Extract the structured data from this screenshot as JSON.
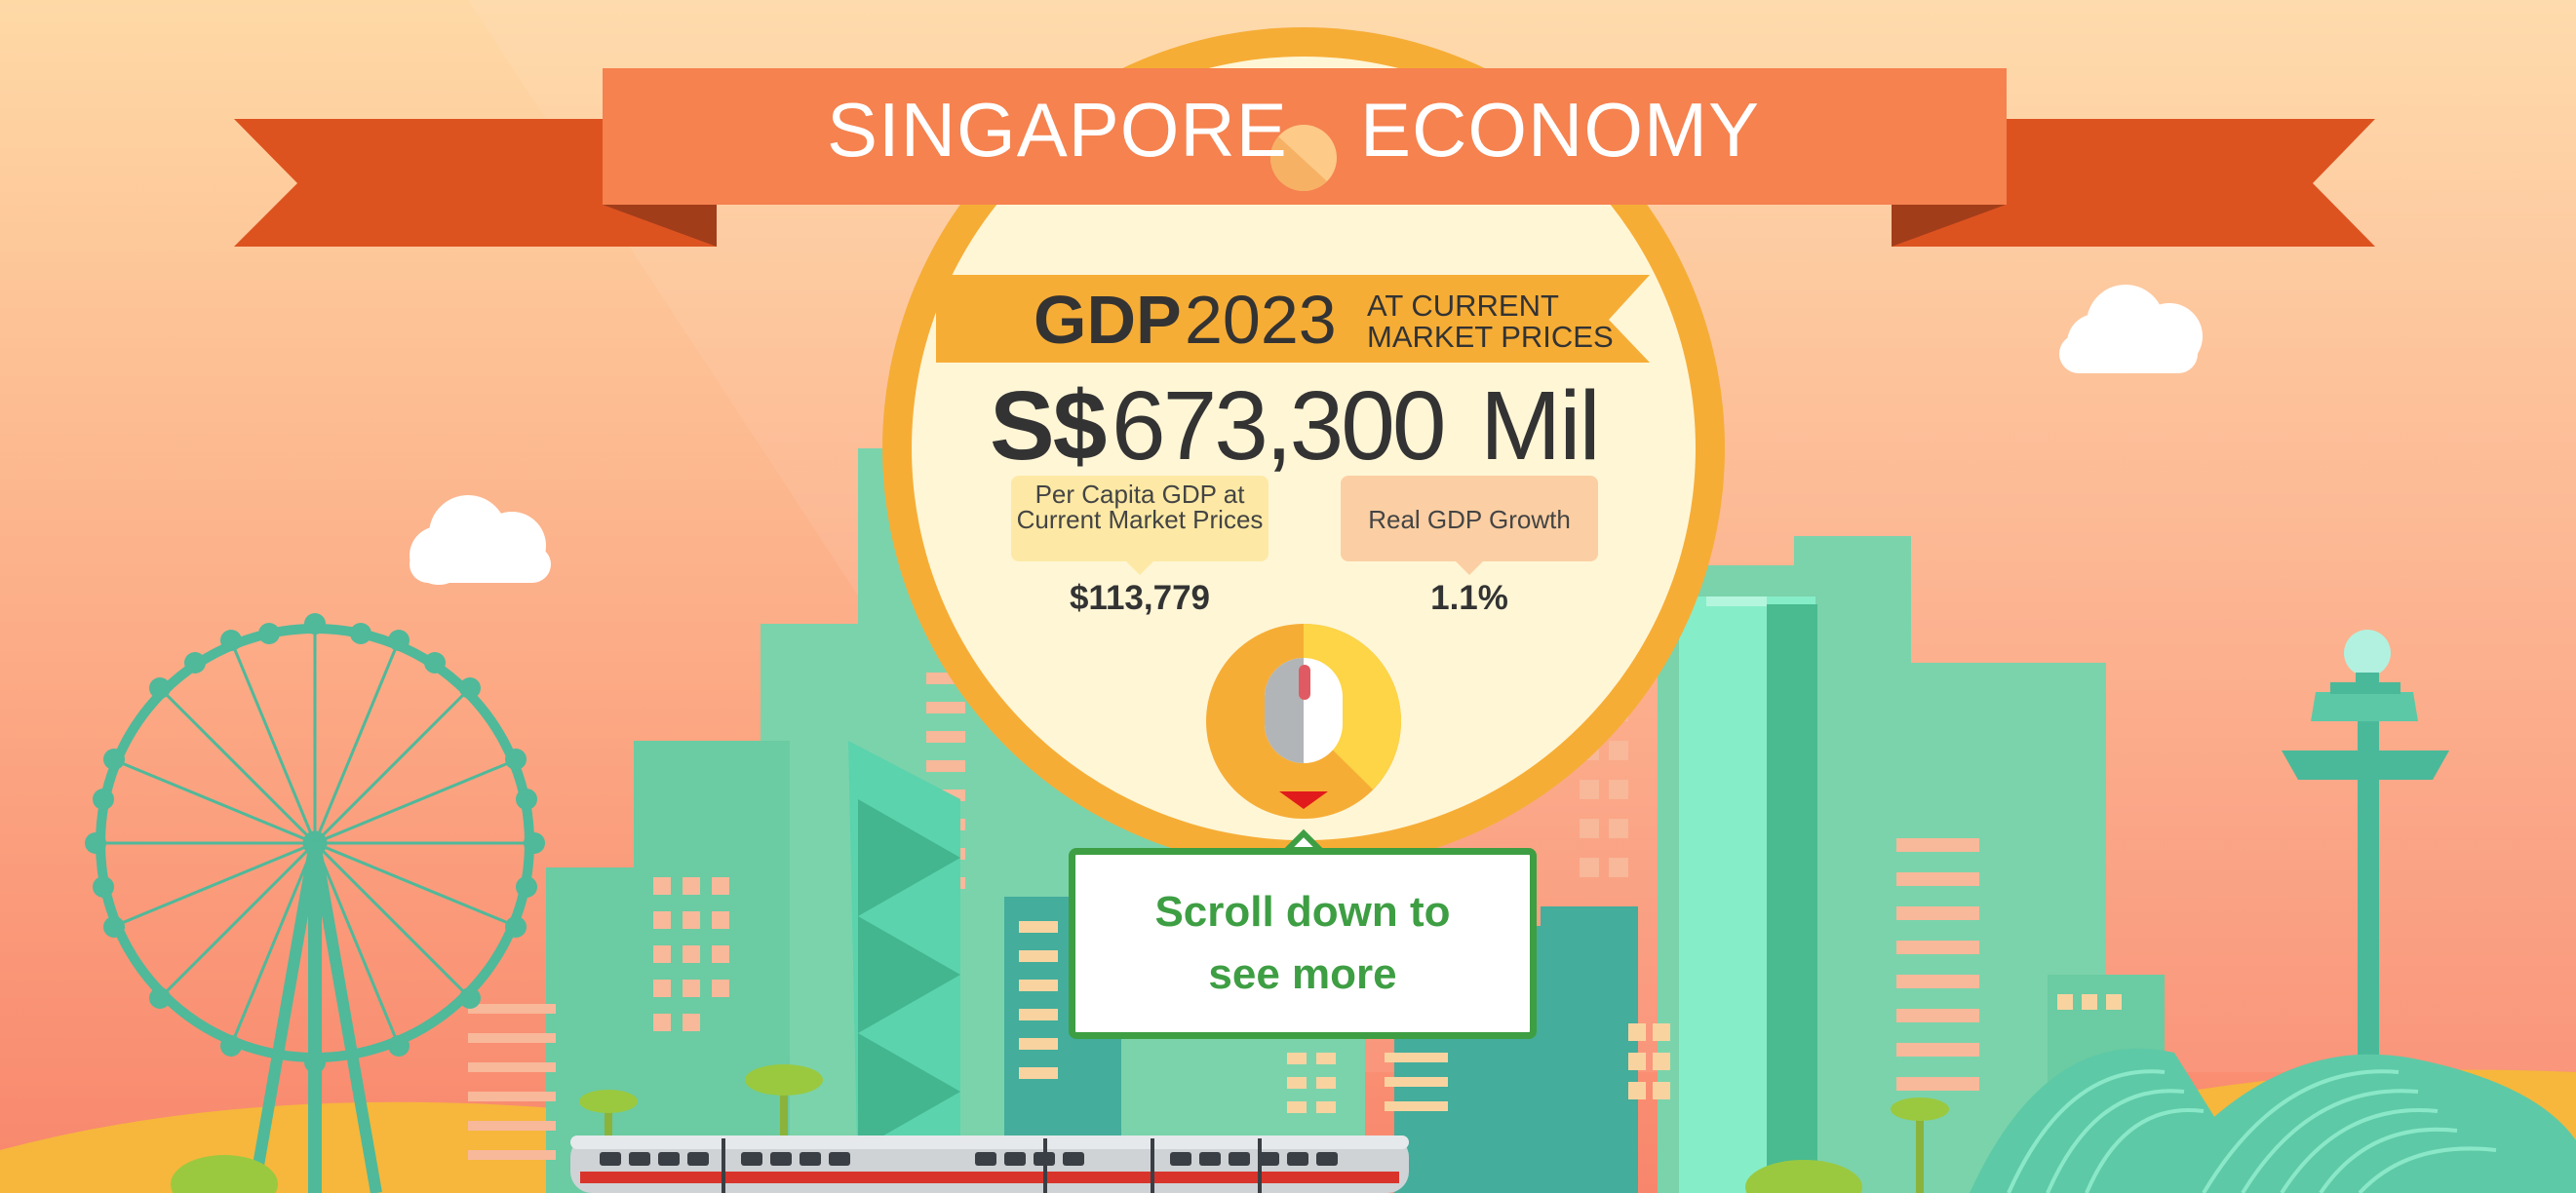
{
  "header": {
    "title_left": "SINGAPORE",
    "title_right": "ECONOMY",
    "logo_icon": "halved-circle-icon"
  },
  "gdp": {
    "label": "GDP",
    "year": "2023",
    "note_line1": "AT CURRENT",
    "note_line2": "MARKET PRICES",
    "currency": "S$",
    "value": "673,300",
    "unit": "Mil"
  },
  "stats": {
    "per_capita": {
      "label": "Per Capita GDP at Current Market Prices",
      "value": "$113,779"
    },
    "growth": {
      "label": "Real GDP Growth",
      "value": "1.1%"
    }
  },
  "scroll_prompt": {
    "text": "Scroll down to see more",
    "icon": "mouse-icon"
  },
  "colors": {
    "sky_top": "#fdd9a4",
    "sky_bottom": "#f98a6e",
    "ribbon": "#f5824f",
    "ribbon_dark": "#dd5320",
    "circle_ring": "#f6ad36",
    "circle_fill": "#fff6d6",
    "accent_green": "#3e9e43",
    "building_teal": "#6fd1b0"
  }
}
